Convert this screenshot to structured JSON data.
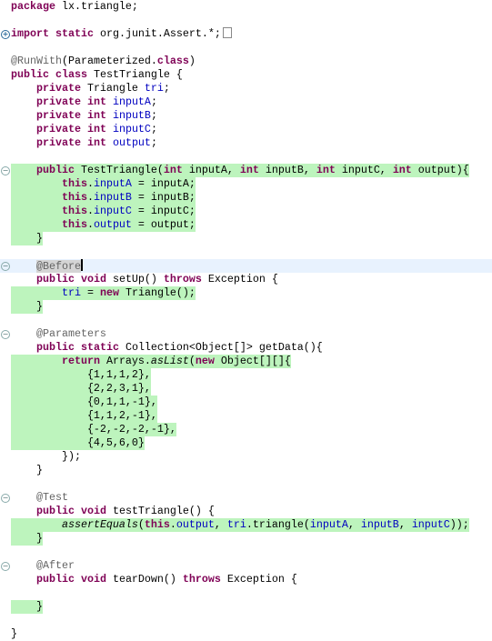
{
  "editor": {
    "highlight_color": "#bdf4bd",
    "current_line": 19,
    "lines": [
      {
        "t": [
          [
            "k",
            "package"
          ],
          [
            "p",
            " lx.triangle;"
          ]
        ]
      },
      {
        "t": []
      },
      {
        "fold": "plus",
        "collapsed": true,
        "t": [
          [
            "k",
            "import"
          ],
          [
            "p",
            " "
          ],
          [
            "k",
            "static"
          ],
          [
            "p",
            " org.junit.Assert.*;"
          ]
        ]
      },
      {
        "t": []
      },
      {
        "t": [
          [
            "a",
            "@RunWith"
          ],
          [
            "p",
            "(Parameterized."
          ],
          [
            "k",
            "class"
          ],
          [
            "p",
            ")"
          ]
        ]
      },
      {
        "t": [
          [
            "k",
            "public"
          ],
          [
            "p",
            " "
          ],
          [
            "k",
            "class"
          ],
          [
            "p",
            " TestTriangle {"
          ]
        ]
      },
      {
        "t": [
          [
            "p",
            "    "
          ],
          [
            "k",
            "private"
          ],
          [
            "p",
            " Triangle "
          ],
          [
            "f",
            "tri"
          ],
          [
            "p",
            ";"
          ]
        ]
      },
      {
        "t": [
          [
            "p",
            "    "
          ],
          [
            "k",
            "private"
          ],
          [
            "p",
            " "
          ],
          [
            "k",
            "int"
          ],
          [
            "p",
            " "
          ],
          [
            "f",
            "inputA"
          ],
          [
            "p",
            ";"
          ]
        ]
      },
      {
        "t": [
          [
            "p",
            "    "
          ],
          [
            "k",
            "private"
          ],
          [
            "p",
            " "
          ],
          [
            "k",
            "int"
          ],
          [
            "p",
            " "
          ],
          [
            "f",
            "inputB"
          ],
          [
            "p",
            ";"
          ]
        ]
      },
      {
        "t": [
          [
            "p",
            "    "
          ],
          [
            "k",
            "private"
          ],
          [
            "p",
            " "
          ],
          [
            "k",
            "int"
          ],
          [
            "p",
            " "
          ],
          [
            "f",
            "inputC"
          ],
          [
            "p",
            ";"
          ]
        ]
      },
      {
        "t": [
          [
            "p",
            "    "
          ],
          [
            "k",
            "private"
          ],
          [
            "p",
            " "
          ],
          [
            "k",
            "int"
          ],
          [
            "p",
            " "
          ],
          [
            "f",
            "output"
          ],
          [
            "p",
            ";"
          ]
        ]
      },
      {
        "t": []
      },
      {
        "fold": "minus",
        "cov": true,
        "t": [
          [
            "p",
            "    "
          ],
          [
            "k",
            "public"
          ],
          [
            "p",
            " TestTriangle("
          ],
          [
            "k",
            "int"
          ],
          [
            "p",
            " inputA, "
          ],
          [
            "k",
            "int"
          ],
          [
            "p",
            " inputB, "
          ],
          [
            "k",
            "int"
          ],
          [
            "p",
            " inputC, "
          ],
          [
            "k",
            "int"
          ],
          [
            "p",
            " output){"
          ]
        ]
      },
      {
        "cov": true,
        "t": [
          [
            "p",
            "        "
          ],
          [
            "k",
            "this"
          ],
          [
            "p",
            "."
          ],
          [
            "f",
            "inputA"
          ],
          [
            "p",
            " = inputA;"
          ]
        ]
      },
      {
        "cov": true,
        "t": [
          [
            "p",
            "        "
          ],
          [
            "k",
            "this"
          ],
          [
            "p",
            "."
          ],
          [
            "f",
            "inputB"
          ],
          [
            "p",
            " = inputB;"
          ]
        ]
      },
      {
        "cov": true,
        "t": [
          [
            "p",
            "        "
          ],
          [
            "k",
            "this"
          ],
          [
            "p",
            "."
          ],
          [
            "f",
            "inputC"
          ],
          [
            "p",
            " = inputC;"
          ]
        ]
      },
      {
        "cov": true,
        "t": [
          [
            "p",
            "        "
          ],
          [
            "k",
            "this"
          ],
          [
            "p",
            "."
          ],
          [
            "f",
            "output"
          ],
          [
            "p",
            " = output;"
          ]
        ]
      },
      {
        "cov": true,
        "t": [
          [
            "p",
            "    }"
          ]
        ]
      },
      {
        "t": []
      },
      {
        "fold": "minus",
        "caret": true,
        "t": [
          [
            "p",
            "    "
          ],
          [
            "a occ",
            "@Before"
          ]
        ]
      },
      {
        "t": [
          [
            "p",
            "    "
          ],
          [
            "k",
            "public"
          ],
          [
            "p",
            " "
          ],
          [
            "k",
            "void"
          ],
          [
            "p",
            " setUp() "
          ],
          [
            "k",
            "throws"
          ],
          [
            "p",
            " Exception {"
          ]
        ]
      },
      {
        "cov": true,
        "t": [
          [
            "p",
            "        "
          ],
          [
            "f",
            "tri"
          ],
          [
            "p",
            " = "
          ],
          [
            "k",
            "new"
          ],
          [
            "p",
            " Triangle();"
          ]
        ]
      },
      {
        "cov": true,
        "t": [
          [
            "p",
            "    }"
          ]
        ]
      },
      {
        "t": []
      },
      {
        "fold": "minus",
        "t": [
          [
            "p",
            "    "
          ],
          [
            "a",
            "@Parameters"
          ]
        ]
      },
      {
        "t": [
          [
            "p",
            "    "
          ],
          [
            "k",
            "public"
          ],
          [
            "p",
            " "
          ],
          [
            "k",
            "static"
          ],
          [
            "p",
            " Collection<Object[]> getData(){"
          ]
        ]
      },
      {
        "cov": true,
        "t": [
          [
            "p",
            "        "
          ],
          [
            "k",
            "return"
          ],
          [
            "p",
            " Arrays."
          ],
          [
            "i",
            "asList"
          ],
          [
            "p",
            "("
          ],
          [
            "k",
            "new"
          ],
          [
            "p",
            " Object[][]{"
          ]
        ]
      },
      {
        "cov": true,
        "t": [
          [
            "p",
            "            {1,1,1,2},"
          ]
        ]
      },
      {
        "cov": true,
        "t": [
          [
            "p",
            "            {2,2,3,1},"
          ]
        ]
      },
      {
        "cov": true,
        "t": [
          [
            "p",
            "            {0,1,1,-1},"
          ]
        ]
      },
      {
        "cov": true,
        "t": [
          [
            "p",
            "            {1,1,2,-1},"
          ]
        ]
      },
      {
        "cov": true,
        "t": [
          [
            "p",
            "            {-2,-2,-2,-1},"
          ]
        ]
      },
      {
        "cov": true,
        "t": [
          [
            "p",
            "            {4,5,6,0}"
          ]
        ]
      },
      {
        "t": [
          [
            "p",
            "        });"
          ]
        ]
      },
      {
        "t": [
          [
            "p",
            "    }"
          ]
        ]
      },
      {
        "t": []
      },
      {
        "fold": "minus",
        "t": [
          [
            "p",
            "    "
          ],
          [
            "a",
            "@Test"
          ]
        ]
      },
      {
        "t": [
          [
            "p",
            "    "
          ],
          [
            "k",
            "public"
          ],
          [
            "p",
            " "
          ],
          [
            "k",
            "void"
          ],
          [
            "p",
            " testTriangle() {"
          ]
        ]
      },
      {
        "cov": true,
        "t": [
          [
            "p",
            "        "
          ],
          [
            "i",
            "assertEquals"
          ],
          [
            "p",
            "("
          ],
          [
            "k",
            "this"
          ],
          [
            "p",
            "."
          ],
          [
            "f",
            "output"
          ],
          [
            "p",
            ", "
          ],
          [
            "f",
            "tri"
          ],
          [
            "p",
            ".triangle("
          ],
          [
            "f",
            "inputA"
          ],
          [
            "p",
            ", "
          ],
          [
            "f",
            "inputB"
          ],
          [
            "p",
            ", "
          ],
          [
            "f",
            "inputC"
          ],
          [
            "p",
            "));"
          ]
        ]
      },
      {
        "cov": true,
        "t": [
          [
            "p",
            "    }"
          ]
        ]
      },
      {
        "t": []
      },
      {
        "fold": "minus",
        "t": [
          [
            "p",
            "    "
          ],
          [
            "a",
            "@After"
          ]
        ]
      },
      {
        "t": [
          [
            "p",
            "    "
          ],
          [
            "k",
            "public"
          ],
          [
            "p",
            " "
          ],
          [
            "k",
            "void"
          ],
          [
            "p",
            " tearDown() "
          ],
          [
            "k",
            "throws"
          ],
          [
            "p",
            " Exception {"
          ]
        ]
      },
      {
        "t": []
      },
      {
        "cov": true,
        "t": [
          [
            "p",
            "    }"
          ]
        ]
      },
      {
        "t": []
      },
      {
        "t": [
          [
            "p",
            "}"
          ]
        ]
      }
    ]
  }
}
